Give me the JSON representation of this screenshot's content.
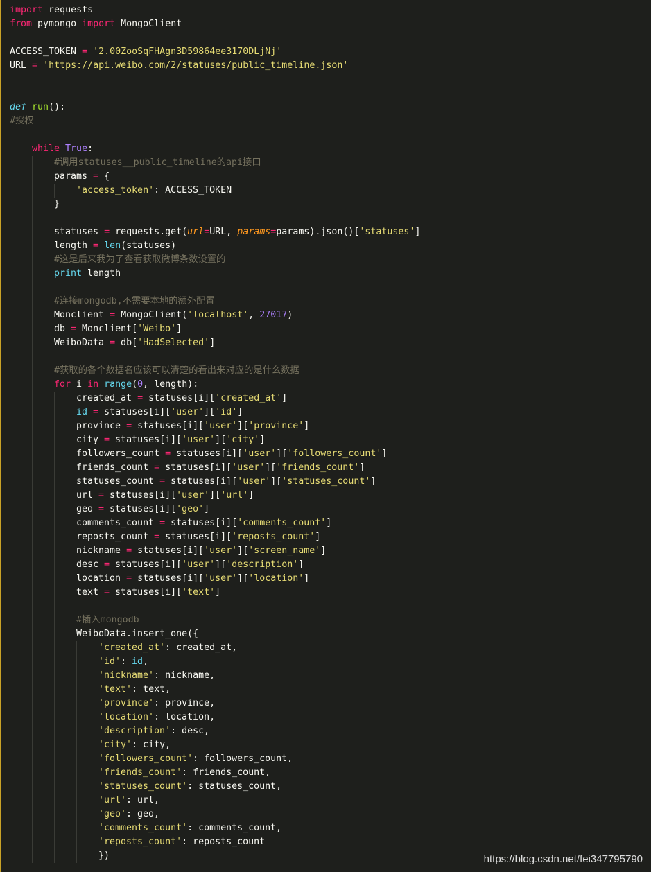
{
  "editor": {
    "theme_colors": {
      "background": "#1e1f1c",
      "keyword": "#f92672",
      "function": "#a6e22e",
      "string": "#e6db74",
      "comment": "#75715e",
      "number": "#ae81ff",
      "builtin": "#66d9ef",
      "argument": "#fd971f",
      "plain": "#f8f8f2"
    },
    "lines": [
      {
        "indent": 0,
        "tokens": [
          [
            "kw",
            "import"
          ],
          [
            "p",
            " requests"
          ]
        ]
      },
      {
        "indent": 0,
        "tokens": [
          [
            "kw",
            "from"
          ],
          [
            "p",
            " pymongo "
          ],
          [
            "kw",
            "import"
          ],
          [
            "p",
            " MongoClient"
          ]
        ]
      },
      {
        "indent": 0,
        "tokens": []
      },
      {
        "indent": 0,
        "tokens": [
          [
            "p",
            "ACCESS_TOKEN "
          ],
          [
            "op",
            "="
          ],
          [
            "p",
            " "
          ],
          [
            "str",
            "'2.00ZooSqFHAgn3D59864ee3170DLjNj'"
          ]
        ]
      },
      {
        "indent": 0,
        "tokens": [
          [
            "p",
            "URL "
          ],
          [
            "op",
            "="
          ],
          [
            "p",
            " "
          ],
          [
            "str",
            "'https://api.weibo.com/2/statuses/public_timeline.json'"
          ]
        ]
      },
      {
        "indent": 0,
        "tokens": []
      },
      {
        "indent": 0,
        "tokens": []
      },
      {
        "indent": 0,
        "tokens": [
          [
            "kw2",
            "def"
          ],
          [
            "p",
            " "
          ],
          [
            "fn",
            "run"
          ],
          [
            "p",
            "():"
          ]
        ]
      },
      {
        "indent": 0,
        "tokens": [
          [
            "cmt",
            "#授权"
          ]
        ]
      },
      {
        "indent": 1,
        "tokens": []
      },
      {
        "indent": 1,
        "tokens": [
          [
            "kw",
            "while"
          ],
          [
            "p",
            " "
          ],
          [
            "cst",
            "True"
          ],
          [
            "p",
            ":"
          ]
        ]
      },
      {
        "indent": 2,
        "tokens": [
          [
            "cmt",
            "#调用statuses__public_timeline的api接口"
          ]
        ]
      },
      {
        "indent": 2,
        "tokens": [
          [
            "p",
            "params "
          ],
          [
            "op",
            "="
          ],
          [
            "p",
            " {"
          ]
        ]
      },
      {
        "indent": 3,
        "tokens": [
          [
            "str",
            "'access_token'"
          ],
          [
            "p",
            ": ACCESS_TOKEN"
          ]
        ]
      },
      {
        "indent": 2,
        "tokens": [
          [
            "p",
            "}"
          ]
        ]
      },
      {
        "indent": 2,
        "tokens": []
      },
      {
        "indent": 2,
        "tokens": [
          [
            "p",
            "statuses "
          ],
          [
            "op",
            "="
          ],
          [
            "p",
            " requests.get("
          ],
          [
            "arg",
            "url"
          ],
          [
            "op",
            "="
          ],
          [
            "p",
            "URL, "
          ],
          [
            "arg",
            "params"
          ],
          [
            "op",
            "="
          ],
          [
            "p",
            "params).json()["
          ],
          [
            "str",
            "'statuses'"
          ],
          [
            "p",
            "]"
          ]
        ]
      },
      {
        "indent": 2,
        "tokens": [
          [
            "p",
            "length "
          ],
          [
            "op",
            "="
          ],
          [
            "p",
            " "
          ],
          [
            "bi",
            "len"
          ],
          [
            "p",
            "(statuses)"
          ]
        ]
      },
      {
        "indent": 2,
        "tokens": [
          [
            "cmt",
            "#这是后来我为了查看获取微博条数设置的"
          ]
        ]
      },
      {
        "indent": 2,
        "tokens": [
          [
            "bi",
            "print"
          ],
          [
            "p",
            " length"
          ]
        ]
      },
      {
        "indent": 2,
        "tokens": []
      },
      {
        "indent": 2,
        "tokens": [
          [
            "cmt",
            "#连接mongodb,不需要本地的额外配置"
          ]
        ]
      },
      {
        "indent": 2,
        "tokens": [
          [
            "p",
            "Monclient "
          ],
          [
            "op",
            "="
          ],
          [
            "p",
            " MongoClient("
          ],
          [
            "str",
            "'localhost'"
          ],
          [
            "p",
            ", "
          ],
          [
            "num",
            "27017"
          ],
          [
            "p",
            ")"
          ]
        ]
      },
      {
        "indent": 2,
        "tokens": [
          [
            "p",
            "db "
          ],
          [
            "op",
            "="
          ],
          [
            "p",
            " Monclient["
          ],
          [
            "str",
            "'Weibo'"
          ],
          [
            "p",
            "]"
          ]
        ]
      },
      {
        "indent": 2,
        "tokens": [
          [
            "p",
            "WeiboData "
          ],
          [
            "op",
            "="
          ],
          [
            "p",
            " db["
          ],
          [
            "str",
            "'HadSelected'"
          ],
          [
            "p",
            "]"
          ]
        ]
      },
      {
        "indent": 2,
        "tokens": []
      },
      {
        "indent": 2,
        "tokens": [
          [
            "cmt",
            "#获取的各个数据名应该可以清楚的看出来对应的是什么数据"
          ]
        ]
      },
      {
        "indent": 2,
        "tokens": [
          [
            "kw",
            "for"
          ],
          [
            "p",
            " i "
          ],
          [
            "kw",
            "in"
          ],
          [
            "p",
            " "
          ],
          [
            "bi",
            "range"
          ],
          [
            "p",
            "("
          ],
          [
            "num",
            "0"
          ],
          [
            "p",
            ", length):"
          ]
        ]
      },
      {
        "indent": 3,
        "tokens": [
          [
            "p",
            "created_at "
          ],
          [
            "op",
            "="
          ],
          [
            "p",
            " statuses[i]["
          ],
          [
            "str",
            "'created_at'"
          ],
          [
            "p",
            "]"
          ]
        ]
      },
      {
        "indent": 3,
        "tokens": [
          [
            "bi",
            "id"
          ],
          [
            "p",
            " "
          ],
          [
            "op",
            "="
          ],
          [
            "p",
            " statuses[i]["
          ],
          [
            "str",
            "'user'"
          ],
          [
            "p",
            "]["
          ],
          [
            "str",
            "'id'"
          ],
          [
            "p",
            "]"
          ]
        ]
      },
      {
        "indent": 3,
        "tokens": [
          [
            "p",
            "province "
          ],
          [
            "op",
            "="
          ],
          [
            "p",
            " statuses[i]["
          ],
          [
            "str",
            "'user'"
          ],
          [
            "p",
            "]["
          ],
          [
            "str",
            "'province'"
          ],
          [
            "p",
            "]"
          ]
        ]
      },
      {
        "indent": 3,
        "tokens": [
          [
            "p",
            "city "
          ],
          [
            "op",
            "="
          ],
          [
            "p",
            " statuses[i]["
          ],
          [
            "str",
            "'user'"
          ],
          [
            "p",
            "]["
          ],
          [
            "str",
            "'city'"
          ],
          [
            "p",
            "]"
          ]
        ]
      },
      {
        "indent": 3,
        "tokens": [
          [
            "p",
            "followers_count "
          ],
          [
            "op",
            "="
          ],
          [
            "p",
            " statuses[i]["
          ],
          [
            "str",
            "'user'"
          ],
          [
            "p",
            "]["
          ],
          [
            "str",
            "'followers_count'"
          ],
          [
            "p",
            "]"
          ]
        ]
      },
      {
        "indent": 3,
        "tokens": [
          [
            "p",
            "friends_count "
          ],
          [
            "op",
            "="
          ],
          [
            "p",
            " statuses[i]["
          ],
          [
            "str",
            "'user'"
          ],
          [
            "p",
            "]["
          ],
          [
            "str",
            "'friends_count'"
          ],
          [
            "p",
            "]"
          ]
        ]
      },
      {
        "indent": 3,
        "tokens": [
          [
            "p",
            "statuses_count "
          ],
          [
            "op",
            "="
          ],
          [
            "p",
            " statuses[i]["
          ],
          [
            "str",
            "'user'"
          ],
          [
            "p",
            "]["
          ],
          [
            "str",
            "'statuses_count'"
          ],
          [
            "p",
            "]"
          ]
        ]
      },
      {
        "indent": 3,
        "tokens": [
          [
            "p",
            "url "
          ],
          [
            "op",
            "="
          ],
          [
            "p",
            " statuses[i]["
          ],
          [
            "str",
            "'user'"
          ],
          [
            "p",
            "]["
          ],
          [
            "str",
            "'url'"
          ],
          [
            "p",
            "]"
          ]
        ]
      },
      {
        "indent": 3,
        "tokens": [
          [
            "p",
            "geo "
          ],
          [
            "op",
            "="
          ],
          [
            "p",
            " statuses[i]["
          ],
          [
            "str",
            "'geo'"
          ],
          [
            "p",
            "]"
          ]
        ]
      },
      {
        "indent": 3,
        "tokens": [
          [
            "p",
            "comments_count "
          ],
          [
            "op",
            "="
          ],
          [
            "p",
            " statuses[i]["
          ],
          [
            "str",
            "'comments_count'"
          ],
          [
            "p",
            "]"
          ]
        ]
      },
      {
        "indent": 3,
        "tokens": [
          [
            "p",
            "reposts_count "
          ],
          [
            "op",
            "="
          ],
          [
            "p",
            " statuses[i]["
          ],
          [
            "str",
            "'reposts_count'"
          ],
          [
            "p",
            "]"
          ]
        ]
      },
      {
        "indent": 3,
        "tokens": [
          [
            "p",
            "nickname "
          ],
          [
            "op",
            "="
          ],
          [
            "p",
            " statuses[i]["
          ],
          [
            "str",
            "'user'"
          ],
          [
            "p",
            "]["
          ],
          [
            "str",
            "'screen_name'"
          ],
          [
            "p",
            "]"
          ]
        ]
      },
      {
        "indent": 3,
        "tokens": [
          [
            "p",
            "desc "
          ],
          [
            "op",
            "="
          ],
          [
            "p",
            " statuses[i]["
          ],
          [
            "str",
            "'user'"
          ],
          [
            "p",
            "]["
          ],
          [
            "str",
            "'description'"
          ],
          [
            "p",
            "]"
          ]
        ]
      },
      {
        "indent": 3,
        "tokens": [
          [
            "p",
            "location "
          ],
          [
            "op",
            "="
          ],
          [
            "p",
            " statuses[i]["
          ],
          [
            "str",
            "'user'"
          ],
          [
            "p",
            "]["
          ],
          [
            "str",
            "'location'"
          ],
          [
            "p",
            "]"
          ]
        ]
      },
      {
        "indent": 3,
        "tokens": [
          [
            "p",
            "text "
          ],
          [
            "op",
            "="
          ],
          [
            "p",
            " statuses[i]["
          ],
          [
            "str",
            "'text'"
          ],
          [
            "p",
            "]"
          ]
        ]
      },
      {
        "indent": 3,
        "tokens": []
      },
      {
        "indent": 3,
        "tokens": [
          [
            "cmt",
            "#插入mongodb"
          ]
        ]
      },
      {
        "indent": 3,
        "tokens": [
          [
            "p",
            "WeiboData.insert_one({"
          ]
        ]
      },
      {
        "indent": 4,
        "tokens": [
          [
            "str",
            "'created_at'"
          ],
          [
            "p",
            ": created_at,"
          ]
        ]
      },
      {
        "indent": 4,
        "tokens": [
          [
            "str",
            "'id'"
          ],
          [
            "p",
            ": "
          ],
          [
            "bi",
            "id"
          ],
          [
            "p",
            ","
          ]
        ]
      },
      {
        "indent": 4,
        "tokens": [
          [
            "str",
            "'nickname'"
          ],
          [
            "p",
            ": nickname,"
          ]
        ]
      },
      {
        "indent": 4,
        "tokens": [
          [
            "str",
            "'text'"
          ],
          [
            "p",
            ": text,"
          ]
        ]
      },
      {
        "indent": 4,
        "tokens": [
          [
            "str",
            "'province'"
          ],
          [
            "p",
            ": province,"
          ]
        ]
      },
      {
        "indent": 4,
        "tokens": [
          [
            "str",
            "'location'"
          ],
          [
            "p",
            ": location,"
          ]
        ]
      },
      {
        "indent": 4,
        "tokens": [
          [
            "str",
            "'description'"
          ],
          [
            "p",
            ": desc,"
          ]
        ]
      },
      {
        "indent": 4,
        "tokens": [
          [
            "str",
            "'city'"
          ],
          [
            "p",
            ": city,"
          ]
        ]
      },
      {
        "indent": 4,
        "tokens": [
          [
            "str",
            "'followers_count'"
          ],
          [
            "p",
            ": followers_count,"
          ]
        ]
      },
      {
        "indent": 4,
        "tokens": [
          [
            "str",
            "'friends_count'"
          ],
          [
            "p",
            ": friends_count,"
          ]
        ]
      },
      {
        "indent": 4,
        "tokens": [
          [
            "str",
            "'statuses_count'"
          ],
          [
            "p",
            ": statuses_count,"
          ]
        ]
      },
      {
        "indent": 4,
        "tokens": [
          [
            "str",
            "'url'"
          ],
          [
            "p",
            ": url,"
          ]
        ]
      },
      {
        "indent": 4,
        "tokens": [
          [
            "str",
            "'geo'"
          ],
          [
            "p",
            ": geo,"
          ]
        ]
      },
      {
        "indent": 4,
        "tokens": [
          [
            "str",
            "'comments_count'"
          ],
          [
            "p",
            ": comments_count,"
          ]
        ]
      },
      {
        "indent": 4,
        "tokens": [
          [
            "str",
            "'reposts_count'"
          ],
          [
            "p",
            ": reposts_count"
          ]
        ]
      },
      {
        "indent": 4,
        "tokens": [
          [
            "p",
            "})"
          ]
        ]
      }
    ]
  },
  "watermark": "https://blog.csdn.net/fei347795790"
}
